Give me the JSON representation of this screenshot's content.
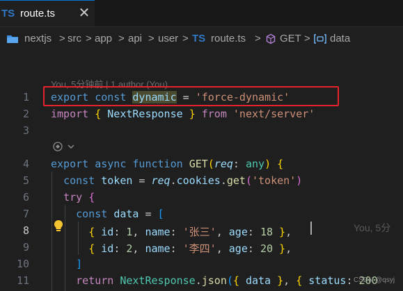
{
  "tab": {
    "badge": "TS",
    "filename": "route.ts",
    "close": "✕"
  },
  "breadcrumb": {
    "items": [
      "nextjs",
      "src",
      "app",
      "api",
      "user",
      "route.ts",
      "GET",
      "data"
    ],
    "ts_badge": "TS",
    "separator": ">"
  },
  "blame": "You, 5分钟前 | 1 author (You)",
  "line_numbers": [
    "1",
    "2",
    "3",
    "4",
    "5",
    "6",
    "7",
    "8",
    "9",
    "10",
    "11"
  ],
  "active_line": "8",
  "ghost_text": "You, 5分",
  "watermark": "CSDN @qsyj",
  "code": {
    "l1": {
      "export": "export",
      "const": "const",
      "name": "dynamic",
      "eq": " = ",
      "value": "'force-dynamic'"
    },
    "l2": {
      "import": "import",
      "open": "{",
      "name": "NextResponse",
      "close": "}",
      "from": "from",
      "src": "'next/server'"
    },
    "l4": {
      "export": "export",
      "async": "async",
      "function": "function",
      "name": "GET",
      "param": "req",
      "colon": ": ",
      "type": "any",
      "brace": "{"
    },
    "l5": {
      "const": "const",
      "var": "token",
      "eq": " = ",
      "req": "req",
      "cookies": "cookies",
      "get": "get",
      "arg": "'token'"
    },
    "l6": {
      "try": "try",
      "brace": "{"
    },
    "l7": {
      "const": "const",
      "var": "data",
      "eq": " = ",
      "bracket": "["
    },
    "l8": {
      "id_key": "id",
      "id_val": "1",
      "name_key": "name",
      "name_val": "'张三'",
      "age_key": "age",
      "age_val": "18"
    },
    "l9": {
      "id_key": "id",
      "id_val": "2",
      "name_key": "name",
      "name_val": "'李四'",
      "age_key": "age",
      "age_val": "20"
    },
    "l10": {
      "bracket": "]"
    },
    "l11": {
      "return": "return",
      "cls": "NextResponse",
      "method": "json",
      "data": "data",
      "status": "status",
      "status_val": "200"
    }
  },
  "colors": {
    "accent": "#0078d4",
    "annotation_box": "#e8232b",
    "ts_blue": "#3178c6"
  }
}
